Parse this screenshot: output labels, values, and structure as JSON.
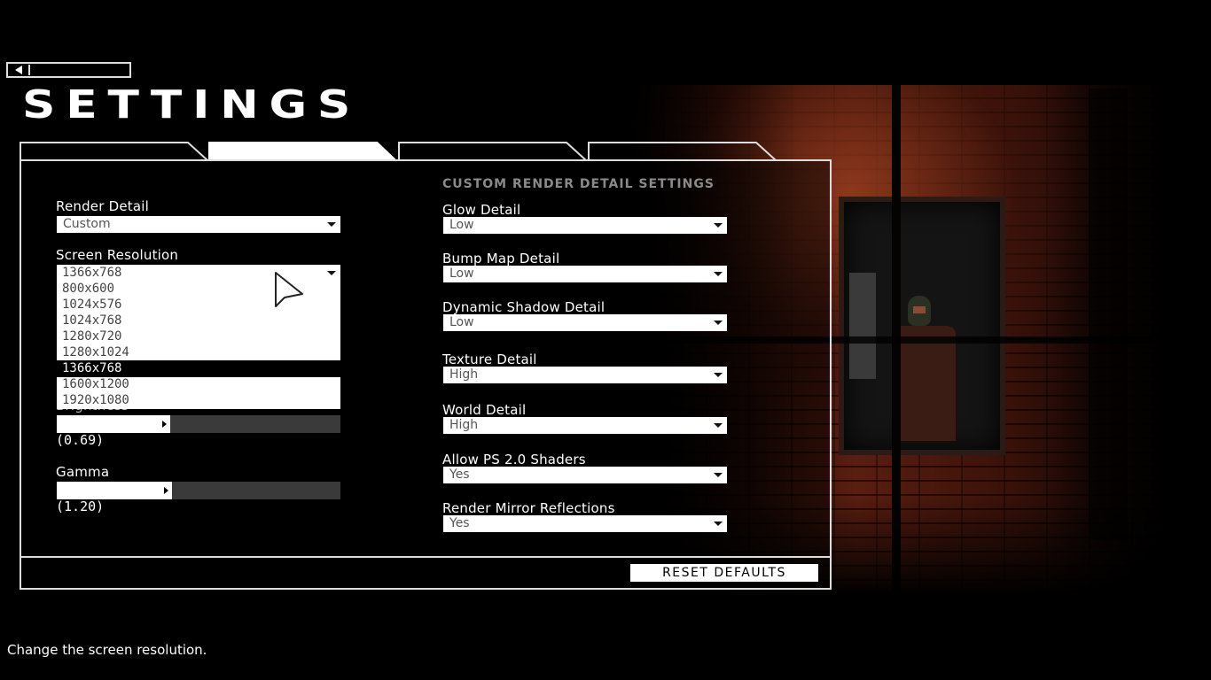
{
  "header": {
    "title": "SETTINGS",
    "back_icon": "back-arrow-icon"
  },
  "tabs": [
    {
      "label": "",
      "active": false
    },
    {
      "label": "",
      "active": true
    },
    {
      "label": "",
      "active": false
    },
    {
      "label": "",
      "active": false
    }
  ],
  "left": {
    "render_detail": {
      "label": "Render Detail",
      "value": "Custom"
    },
    "screen_resolution": {
      "label": "Screen Resolution",
      "value": "1366x768",
      "options": [
        "800x600",
        "1024x576",
        "1024x768",
        "1280x720",
        "1280x1024",
        "1366x768",
        "1600x1200",
        "1920x1080"
      ],
      "highlighted": "1366x768"
    },
    "brightness": {
      "label": "Brightness",
      "value": 0.69,
      "display": "(0.69)",
      "fraction": 0.4
    },
    "gamma": {
      "label": "Gamma",
      "value": 1.2,
      "display": "(1.20)",
      "fraction": 0.405
    }
  },
  "right": {
    "heading": "CUSTOM RENDER DETAIL SETTINGS",
    "settings": [
      {
        "label": "Glow Detail",
        "value": "Low"
      },
      {
        "label": "Bump Map Detail",
        "value": "Low"
      },
      {
        "label": "Dynamic Shadow Detail",
        "value": "Low"
      },
      {
        "label": "Texture Detail",
        "value": "High"
      },
      {
        "label": "World Detail",
        "value": "High"
      },
      {
        "label": "Allow PS 2.0 Shaders",
        "value": "Yes"
      },
      {
        "label": "Render Mirror Reflections",
        "value": "Yes"
      }
    ]
  },
  "footer": {
    "reset_label": "RESET DEFAULTS"
  },
  "status": {
    "help_text": "Change the screen resolution."
  },
  "colors": {
    "accent": "#ffffff",
    "heading_gray": "#8a8a8a",
    "slider_track": "#3a3a3a"
  }
}
